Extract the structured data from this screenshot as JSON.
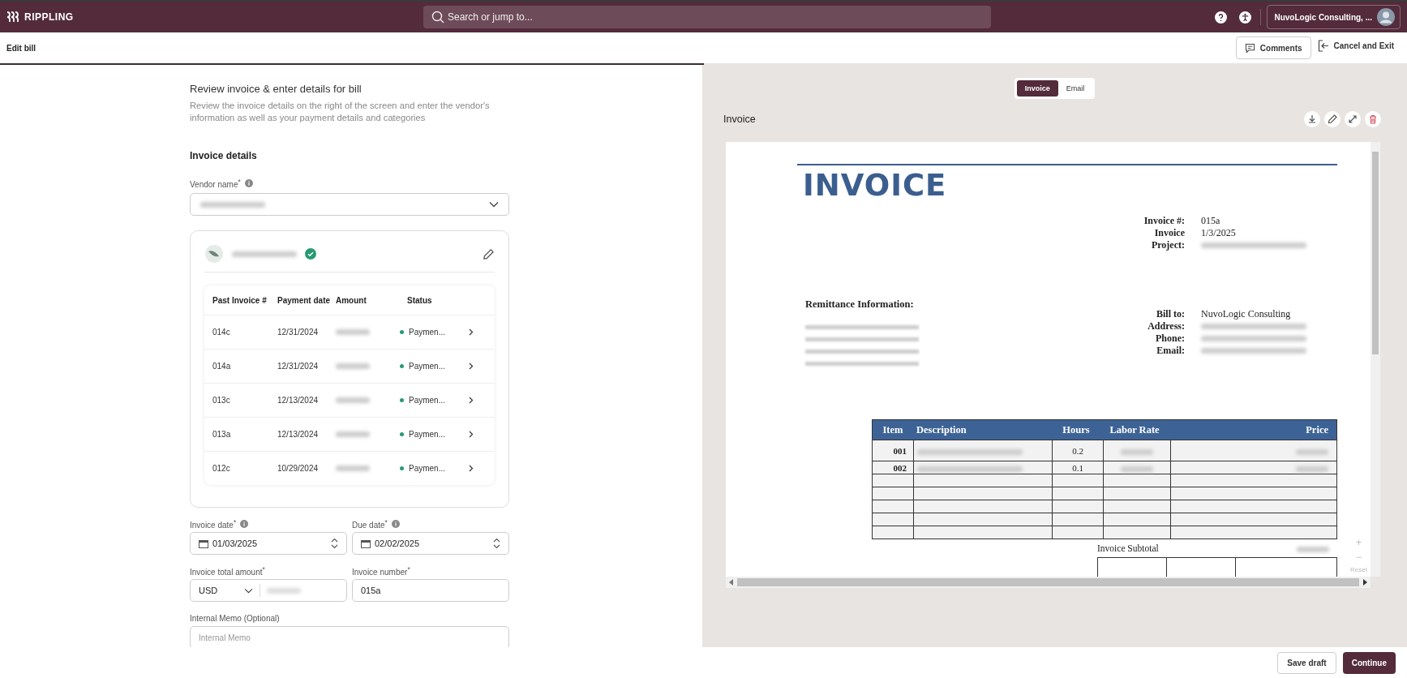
{
  "topbar": {
    "logo": "RIPPLING",
    "search": {
      "placeholder": "Search or jump to..."
    },
    "account": "NuvoLogic Consulting, ..."
  },
  "header": {
    "title": "Edit bill",
    "progress": {
      "level": 0.5
    },
    "comments": "Comments",
    "cancel": "Cancel and Exit"
  },
  "form": {
    "heading": "Review invoice & enter details for bill",
    "description": "Review the invoice details on the right of the screen and enter the vendor's information as well as your payment details and categories",
    "section": "Invoice details",
    "vendor": {
      "label": "Vendor name$^{*}$",
      "verified": true
    },
    "past_invoices": {
      "columns": [
        "Past Invoice #",
        "Payment date",
        "Amount",
        "Status"
      ],
      "rows": [
        {
          "invoice": "014c",
          "date": "12/31/2024",
          "status": "Paymen..."
        },
        {
          "invoice": "014a",
          "date": "12/31/2024",
          "status": "Paymen..."
        },
        {
          "invoice": "013c",
          "date": "12/13/2024",
          "status": "Paymen..."
        },
        {
          "invoice": "013a",
          "date": "12/13/2024",
          "status": "Paymen..."
        },
        {
          "invoice": "012c",
          "date": "10/29/2024",
          "status": "Paymen..."
        }
      ]
    },
    "invoice_date": {
      "label": "Invoice date$^{*}$",
      "value": "01/03/2025"
    },
    "due_date": {
      "label": "Due date$^{*}$",
      "value": "02/02/2025"
    },
    "total": {
      "label": "Invoice total amount$^{*}$",
      "currency": "USD"
    },
    "number": {
      "label": "Invoice number$^{*}$",
      "value": "015a"
    },
    "memo": {
      "label": "Internal Memo (Optional)",
      "placeholder": "Internal Memo"
    }
  },
  "viewer": {
    "tabs": [
      {
        "label": "Invoice",
        "selected": true
      },
      {
        "label": "Email",
        "selected": false
      }
    ],
    "title": "Invoice",
    "document": {
      "title": "INVOICE",
      "meta": [
        {
          "label": "Invoice #:",
          "kind": "text",
          "value": "015a"
        },
        {
          "label": "Invoice",
          "kind": "text",
          "value": "1/3/2025"
        },
        {
          "label": "Project:",
          "kind": "redacted"
        }
      ],
      "remittance": "Remittance Information:",
      "bill": [
        {
          "label": "Bill to:",
          "kind": "text",
          "value": "NuvoLogic Consulting"
        },
        {
          "label": "Address:",
          "kind": "redacted"
        },
        {
          "label": "Phone:",
          "kind": "redacted"
        },
        {
          "label": "Email:",
          "kind": "redacted"
        }
      ],
      "columns": [
        "Item",
        "Description",
        "Hours",
        "Labor Rate",
        "Price"
      ],
      "rows": [
        {
          "item": "001",
          "hours": "0.2"
        },
        {
          "item": "002",
          "hours": "0.1"
        }
      ],
      "subtotal": "Invoice Subtotal"
    },
    "zoom": {
      "in": "+",
      "out": "−",
      "reset": "Reset"
    }
  },
  "footer": {
    "save": "Save draft",
    "continue": "Continue"
  }
}
